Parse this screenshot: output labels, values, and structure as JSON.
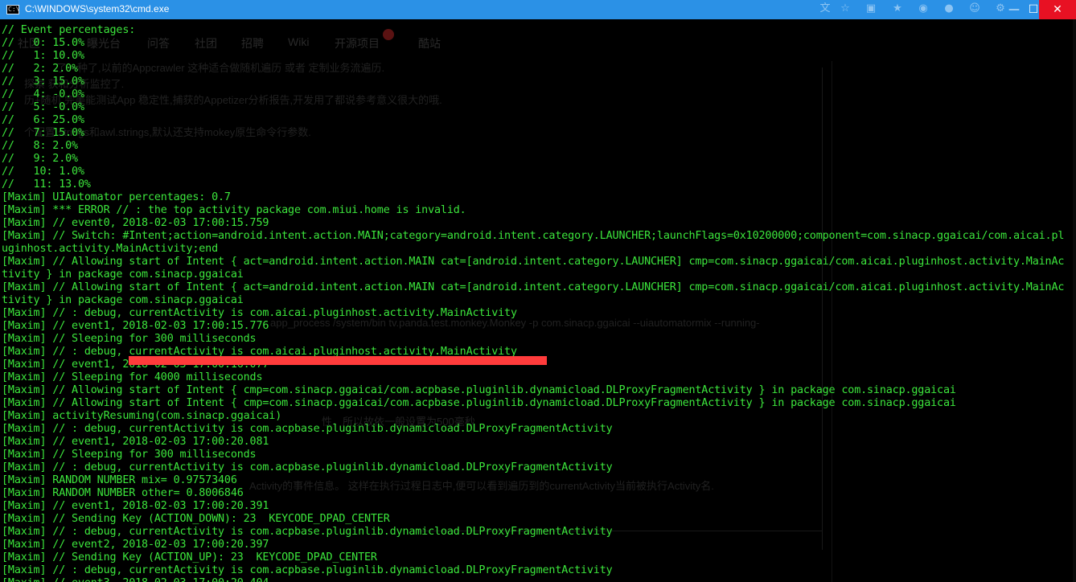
{
  "window": {
    "title": "C:\\WINDOWS\\system32\\cmd.exe",
    "icon": "cmd-icon",
    "icon_text": "C:\\",
    "minimize": "—",
    "maximize": "☐",
    "close": "✕"
  },
  "ghost": {
    "nav": [
      "社区",
      "曝光台",
      "问答",
      "社团",
      "招聘",
      "Wiki",
      "开源项目",
      "酷站"
    ],
    "lines": [
      "了一种了,以前的Appcrawler 这种适合做随机遍历 或者 定制业务流遍历.",
      "探索 获和分析监控了.",
      "历+随机 完美能测试App 稳定性,捕获的Appetizer分析报告,开发用了都说参考意义很大的哦.",
      "个配置 strings和awl.strings,默认还支持mokey原生命令行参数.",
      "app_process /system/bin tv.panda.test.monkey.Monkey -p com.sinacp.ggaicai --uiautomatormix --running-",
      "性，所以故依一般设置为500毫秒",
      "Activity的事件信息。 这样在执行过程日志中,便可以看到遍历到的currentActivity当前被执行Activity名."
    ]
  },
  "console_lines": [
    "// Event percentages:",
    "//   0: 15.0%",
    "//   1: 10.0%",
    "//   2: 2.0%",
    "//   3: 15.0%",
    "//   4: -0.0%",
    "//   5: -0.0%",
    "//   6: 25.0%",
    "//   7: 15.0%",
    "//   8: 2.0%",
    "//   9: 2.0%",
    "//   10: 1.0%",
    "//   11: 13.0%",
    "[Maxim] UIAutomator percentages: 0.7",
    "[Maxim] *** ERROR // : the top activity package com.miui.home is invalid.",
    "[Maxim] // event0, 2018-02-03 17:00:15.759",
    "[Maxim] // Switch: #Intent;action=android.intent.action.MAIN;category=android.intent.category.LAUNCHER;launchFlags=0x10200000;component=com.sinacp.ggaicai/com.aicai.pl",
    "uginhost.activity.MainActivity;end",
    "[Maxim] // Allowing start of Intent { act=android.intent.action.MAIN cat=[android.intent.category.LAUNCHER] cmp=com.sinacp.ggaicai/com.aicai.pluginhost.activity.MainAc",
    "tivity } in package com.sinacp.ggaicai",
    "[Maxim] // Allowing start of Intent { act=android.intent.action.MAIN cat=[android.intent.category.LAUNCHER] cmp=com.sinacp.ggaicai/com.aicai.pluginhost.activity.MainAc",
    "tivity } in package com.sinacp.ggaicai",
    "[Maxim] // : debug, currentActivity is com.aicai.pluginhost.activity.MainActivity",
    "[Maxim] // event1, 2018-02-03 17:00:15.776",
    "[Maxim] // Sleeping for 300 milliseconds",
    "[Maxim] // : debug, currentActivity is com.aicai.pluginhost.activity.MainActivity",
    "[Maxim] // event1, 2018-02-03 17:00:16.077",
    "[Maxim] // Sleeping for 4000 milliseconds",
    "[Maxim] // Allowing start of Intent { cmp=com.sinacp.ggaicai/com.acpbase.pluginlib.dynamicload.DLProxyFragmentActivity } in package com.sinacp.ggaicai",
    "[Maxim] // Allowing start of Intent { cmp=com.sinacp.ggaicai/com.acpbase.pluginlib.dynamicload.DLProxyFragmentActivity } in package com.sinacp.ggaicai",
    "[Maxim] activityResuming(com.sinacp.ggaicai)",
    "[Maxim] // : debug, currentActivity is com.acpbase.pluginlib.dynamicload.DLProxyFragmentActivity",
    "[Maxim] // event1, 2018-02-03 17:00:20.081",
    "[Maxim] // Sleeping for 300 milliseconds",
    "[Maxim] // : debug, currentActivity is com.acpbase.pluginlib.dynamicload.DLProxyFragmentActivity",
    "[Maxim] RANDOM NUMBER mix= 0.97573406",
    "[Maxim] RANDOM NUMBER other= 0.8006846",
    "[Maxim] // event1, 2018-02-03 17:00:20.391",
    "[Maxim] // Sending Key (ACTION_DOWN): 23  KEYCODE_DPAD_CENTER",
    "[Maxim] // : debug, currentActivity is com.acpbase.pluginlib.dynamicload.DLProxyFragmentActivity",
    "[Maxim] // event2, 2018-02-03 17:00:20.397",
    "[Maxim] // Sending Key (ACTION_UP): 23  KEYCODE_DPAD_CENTER",
    "[Maxim] // : debug, currentActivity is com.acpbase.pluginlib.dynamicload.DLProxyFragmentActivity",
    "[Maxim] // event3, 2018-02-03 17:00:20.404"
  ],
  "colors": {
    "titlebar": "#2b91e6",
    "console_text": "#3ce63c",
    "console_bg": "#000000",
    "redaction": "#ff3b3b",
    "close_button": "#e81123"
  }
}
